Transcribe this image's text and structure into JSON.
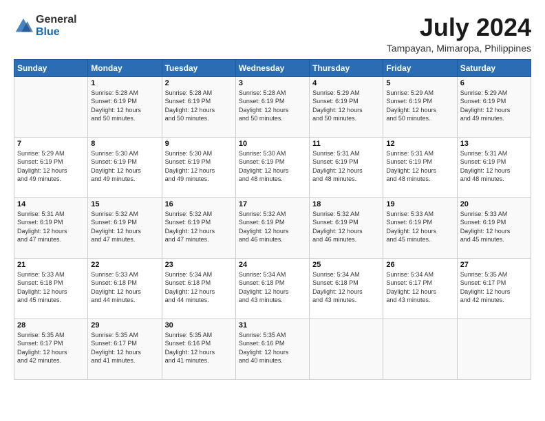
{
  "header": {
    "logo_general": "General",
    "logo_blue": "Blue",
    "title": "July 2024",
    "subtitle": "Tampayan, Mimaropa, Philippines"
  },
  "days_of_week": [
    "Sunday",
    "Monday",
    "Tuesday",
    "Wednesday",
    "Thursday",
    "Friday",
    "Saturday"
  ],
  "weeks": [
    [
      {
        "day": "",
        "info": ""
      },
      {
        "day": "1",
        "info": "Sunrise: 5:28 AM\nSunset: 6:19 PM\nDaylight: 12 hours\nand 50 minutes."
      },
      {
        "day": "2",
        "info": "Sunrise: 5:28 AM\nSunset: 6:19 PM\nDaylight: 12 hours\nand 50 minutes."
      },
      {
        "day": "3",
        "info": "Sunrise: 5:28 AM\nSunset: 6:19 PM\nDaylight: 12 hours\nand 50 minutes."
      },
      {
        "day": "4",
        "info": "Sunrise: 5:29 AM\nSunset: 6:19 PM\nDaylight: 12 hours\nand 50 minutes."
      },
      {
        "day": "5",
        "info": "Sunrise: 5:29 AM\nSunset: 6:19 PM\nDaylight: 12 hours\nand 50 minutes."
      },
      {
        "day": "6",
        "info": "Sunrise: 5:29 AM\nSunset: 6:19 PM\nDaylight: 12 hours\nand 49 minutes."
      }
    ],
    [
      {
        "day": "7",
        "info": "Sunrise: 5:29 AM\nSunset: 6:19 PM\nDaylight: 12 hours\nand 49 minutes."
      },
      {
        "day": "8",
        "info": "Sunrise: 5:30 AM\nSunset: 6:19 PM\nDaylight: 12 hours\nand 49 minutes."
      },
      {
        "day": "9",
        "info": "Sunrise: 5:30 AM\nSunset: 6:19 PM\nDaylight: 12 hours\nand 49 minutes."
      },
      {
        "day": "10",
        "info": "Sunrise: 5:30 AM\nSunset: 6:19 PM\nDaylight: 12 hours\nand 48 minutes."
      },
      {
        "day": "11",
        "info": "Sunrise: 5:31 AM\nSunset: 6:19 PM\nDaylight: 12 hours\nand 48 minutes."
      },
      {
        "day": "12",
        "info": "Sunrise: 5:31 AM\nSunset: 6:19 PM\nDaylight: 12 hours\nand 48 minutes."
      },
      {
        "day": "13",
        "info": "Sunrise: 5:31 AM\nSunset: 6:19 PM\nDaylight: 12 hours\nand 48 minutes."
      }
    ],
    [
      {
        "day": "14",
        "info": "Sunrise: 5:31 AM\nSunset: 6:19 PM\nDaylight: 12 hours\nand 47 minutes."
      },
      {
        "day": "15",
        "info": "Sunrise: 5:32 AM\nSunset: 6:19 PM\nDaylight: 12 hours\nand 47 minutes."
      },
      {
        "day": "16",
        "info": "Sunrise: 5:32 AM\nSunset: 6:19 PM\nDaylight: 12 hours\nand 47 minutes."
      },
      {
        "day": "17",
        "info": "Sunrise: 5:32 AM\nSunset: 6:19 PM\nDaylight: 12 hours\nand 46 minutes."
      },
      {
        "day": "18",
        "info": "Sunrise: 5:32 AM\nSunset: 6:19 PM\nDaylight: 12 hours\nand 46 minutes."
      },
      {
        "day": "19",
        "info": "Sunrise: 5:33 AM\nSunset: 6:19 PM\nDaylight: 12 hours\nand 45 minutes."
      },
      {
        "day": "20",
        "info": "Sunrise: 5:33 AM\nSunset: 6:19 PM\nDaylight: 12 hours\nand 45 minutes."
      }
    ],
    [
      {
        "day": "21",
        "info": "Sunrise: 5:33 AM\nSunset: 6:18 PM\nDaylight: 12 hours\nand 45 minutes."
      },
      {
        "day": "22",
        "info": "Sunrise: 5:33 AM\nSunset: 6:18 PM\nDaylight: 12 hours\nand 44 minutes."
      },
      {
        "day": "23",
        "info": "Sunrise: 5:34 AM\nSunset: 6:18 PM\nDaylight: 12 hours\nand 44 minutes."
      },
      {
        "day": "24",
        "info": "Sunrise: 5:34 AM\nSunset: 6:18 PM\nDaylight: 12 hours\nand 43 minutes."
      },
      {
        "day": "25",
        "info": "Sunrise: 5:34 AM\nSunset: 6:18 PM\nDaylight: 12 hours\nand 43 minutes."
      },
      {
        "day": "26",
        "info": "Sunrise: 5:34 AM\nSunset: 6:17 PM\nDaylight: 12 hours\nand 43 minutes."
      },
      {
        "day": "27",
        "info": "Sunrise: 5:35 AM\nSunset: 6:17 PM\nDaylight: 12 hours\nand 42 minutes."
      }
    ],
    [
      {
        "day": "28",
        "info": "Sunrise: 5:35 AM\nSunset: 6:17 PM\nDaylight: 12 hours\nand 42 minutes."
      },
      {
        "day": "29",
        "info": "Sunrise: 5:35 AM\nSunset: 6:17 PM\nDaylight: 12 hours\nand 41 minutes."
      },
      {
        "day": "30",
        "info": "Sunrise: 5:35 AM\nSunset: 6:16 PM\nDaylight: 12 hours\nand 41 minutes."
      },
      {
        "day": "31",
        "info": "Sunrise: 5:35 AM\nSunset: 6:16 PM\nDaylight: 12 hours\nand 40 minutes."
      },
      {
        "day": "",
        "info": ""
      },
      {
        "day": "",
        "info": ""
      },
      {
        "day": "",
        "info": ""
      }
    ]
  ]
}
